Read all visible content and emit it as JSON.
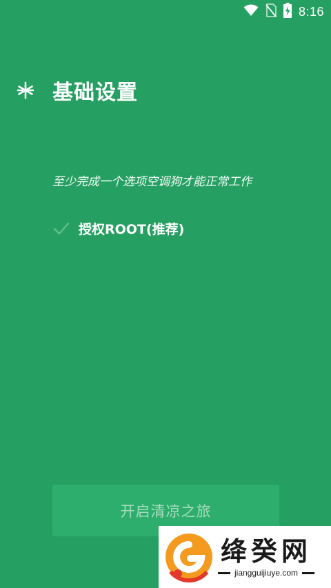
{
  "status_bar": {
    "time": "8:16",
    "icons": [
      "wifi-icon",
      "no-sim-icon",
      "battery-charging-icon"
    ]
  },
  "header": {
    "icon": "snowflake-icon",
    "title": "基础设置"
  },
  "main": {
    "subtitle": "至少完成一个选项空调狗才能正常工作",
    "options": [
      {
        "icon": "check-icon",
        "label": "授权ROOT(推荐)",
        "checked": true
      }
    ],
    "start_button_label": "开启清凉之旅"
  },
  "watermark": {
    "title": "绛癸网",
    "url": "jiangguijiuye.com"
  },
  "colors": {
    "background": "#26a062",
    "button_bg": "#2eae6c",
    "button_text": "#a8dcbf",
    "check": "#5fbf8b"
  }
}
